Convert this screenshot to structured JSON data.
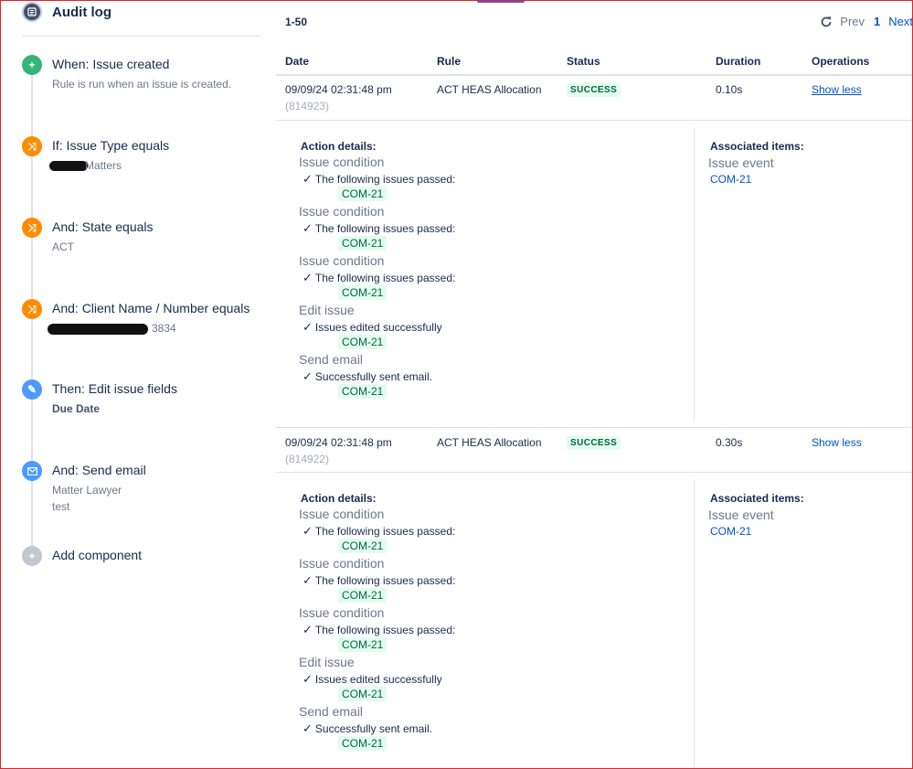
{
  "sidebar": {
    "title": "Audit log",
    "steps": [
      {
        "title": "When: Issue created",
        "desc": "Rule is run when an issue is created."
      },
      {
        "title": "If: Issue Type equals",
        "desc": "Matters"
      },
      {
        "title": "And: State equals",
        "desc": "ACT"
      },
      {
        "title": "And: Client Name / Number equals",
        "desc": "3834"
      },
      {
        "title": "Then: Edit issue fields",
        "desc": "Due Date"
      },
      {
        "title": "And: Send email",
        "desc": "Matter Lawyer",
        "desc2": "test"
      },
      {
        "title": "Add component"
      }
    ]
  },
  "main": {
    "range": "1-50",
    "pager": {
      "prev": "Prev",
      "page": "1",
      "next": "Next"
    },
    "columns": {
      "date": "Date",
      "rule": "Rule",
      "status": "Status",
      "duration": "Duration",
      "operations": "Operations"
    },
    "rows": [
      {
        "date": "09/09/24 02:31:48 pm",
        "id": "(814923)",
        "rule": "ACT HEAS Allocation",
        "status": "SUCCESS",
        "duration": "0.10s",
        "op": "Show less"
      },
      {
        "date": "09/09/24 02:31:48 pm",
        "id": "(814922)",
        "rule": "ACT HEAS Allocation",
        "status": "SUCCESS",
        "duration": "0.30s",
        "op": "Show less"
      }
    ],
    "details": [
      {
        "action_title": "Action details:",
        "actions": [
          {
            "name": "Issue condition",
            "msg": "The following issues passed:",
            "key": "COM-21"
          },
          {
            "name": "Issue condition",
            "msg": "The following issues passed:",
            "key": "COM-21"
          },
          {
            "name": "Issue condition",
            "msg": "The following issues passed:",
            "key": "COM-21"
          },
          {
            "name": "Edit issue",
            "msg": "Issues edited successfully",
            "key": "COM-21"
          },
          {
            "name": "Send email",
            "msg": "Successfully sent email.",
            "key": "COM-21"
          }
        ],
        "assoc_title": "Associated items:",
        "assoc_name": "Issue event",
        "assoc_key": "COM-21"
      },
      {
        "action_title": "Action details:",
        "actions": [
          {
            "name": "Issue condition",
            "msg": "The following issues passed:",
            "key": "COM-21"
          },
          {
            "name": "Issue condition",
            "msg": "The following issues passed:",
            "key": "COM-21"
          },
          {
            "name": "Issue condition",
            "msg": "The following issues passed:",
            "key": "COM-21"
          },
          {
            "name": "Edit issue",
            "msg": "Issues edited successfully",
            "key": "COM-21"
          },
          {
            "name": "Send email",
            "msg": "Successfully sent email.",
            "key": "COM-21"
          }
        ],
        "assoc_title": "Associated items:",
        "assoc_name": "Issue event",
        "assoc_key": "COM-21"
      }
    ]
  },
  "colors": {
    "success_bg": "#e3fcef",
    "success_text": "#006644",
    "link": "#0052cc",
    "trigger": "#36b37e",
    "condition": "#ff8b00",
    "action": "#4c9aff"
  }
}
